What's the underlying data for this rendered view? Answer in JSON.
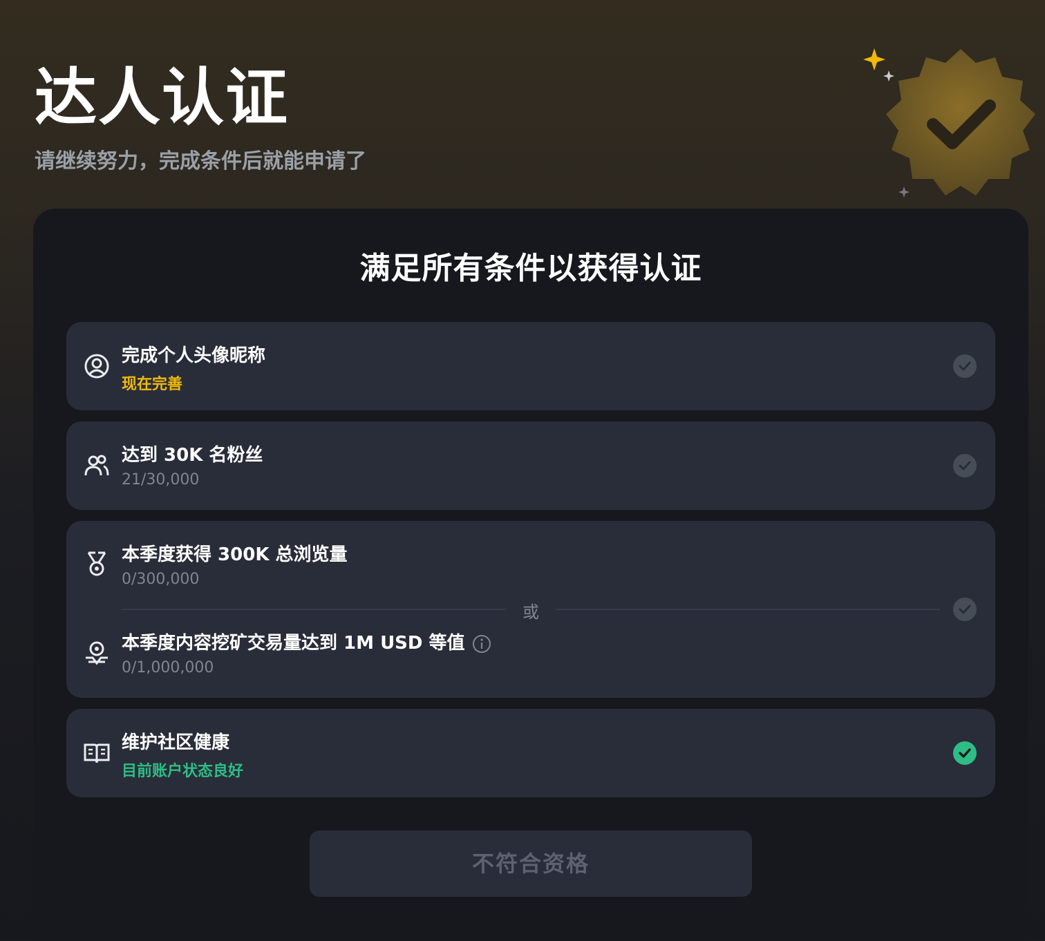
{
  "header": {
    "title": "达人认证",
    "subtitle": "请继续努力，完成条件后就能申请了",
    "badge_icon": "verified-badge-icon"
  },
  "card": {
    "title": "满足所有条件以获得认证"
  },
  "requirements": [
    {
      "icon": "user-circle-icon",
      "label": "完成个人头像昵称",
      "sub": "现在完善",
      "sub_color": "#f0b90b",
      "status": "incomplete"
    },
    {
      "icon": "users-icon",
      "label": "达到 30K 名粉丝",
      "sub": "21/30,000",
      "status": "incomplete"
    },
    {
      "group": [
        {
          "icon": "medal-icon",
          "label": "本季度获得 300K 总浏览量",
          "sub": "0/300,000"
        },
        {
          "icon": "location-coin-icon",
          "label": "本季度内容挖矿交易量达到 1M USD 等值",
          "sub": "0/1,000,000",
          "has_info_icon": true
        }
      ],
      "separator": "或",
      "status": "incomplete"
    },
    {
      "icon": "book-icon",
      "label": "维护社区健康",
      "sub": "目前账户状态良好",
      "sub_color": "#2ebd85",
      "status": "complete"
    }
  ],
  "cta": {
    "label": "不符合资格",
    "disabled": true
  },
  "colors": {
    "accent_yellow": "#f0b90b",
    "success_green": "#2ebd85",
    "incomplete_gray": "#474d57"
  }
}
